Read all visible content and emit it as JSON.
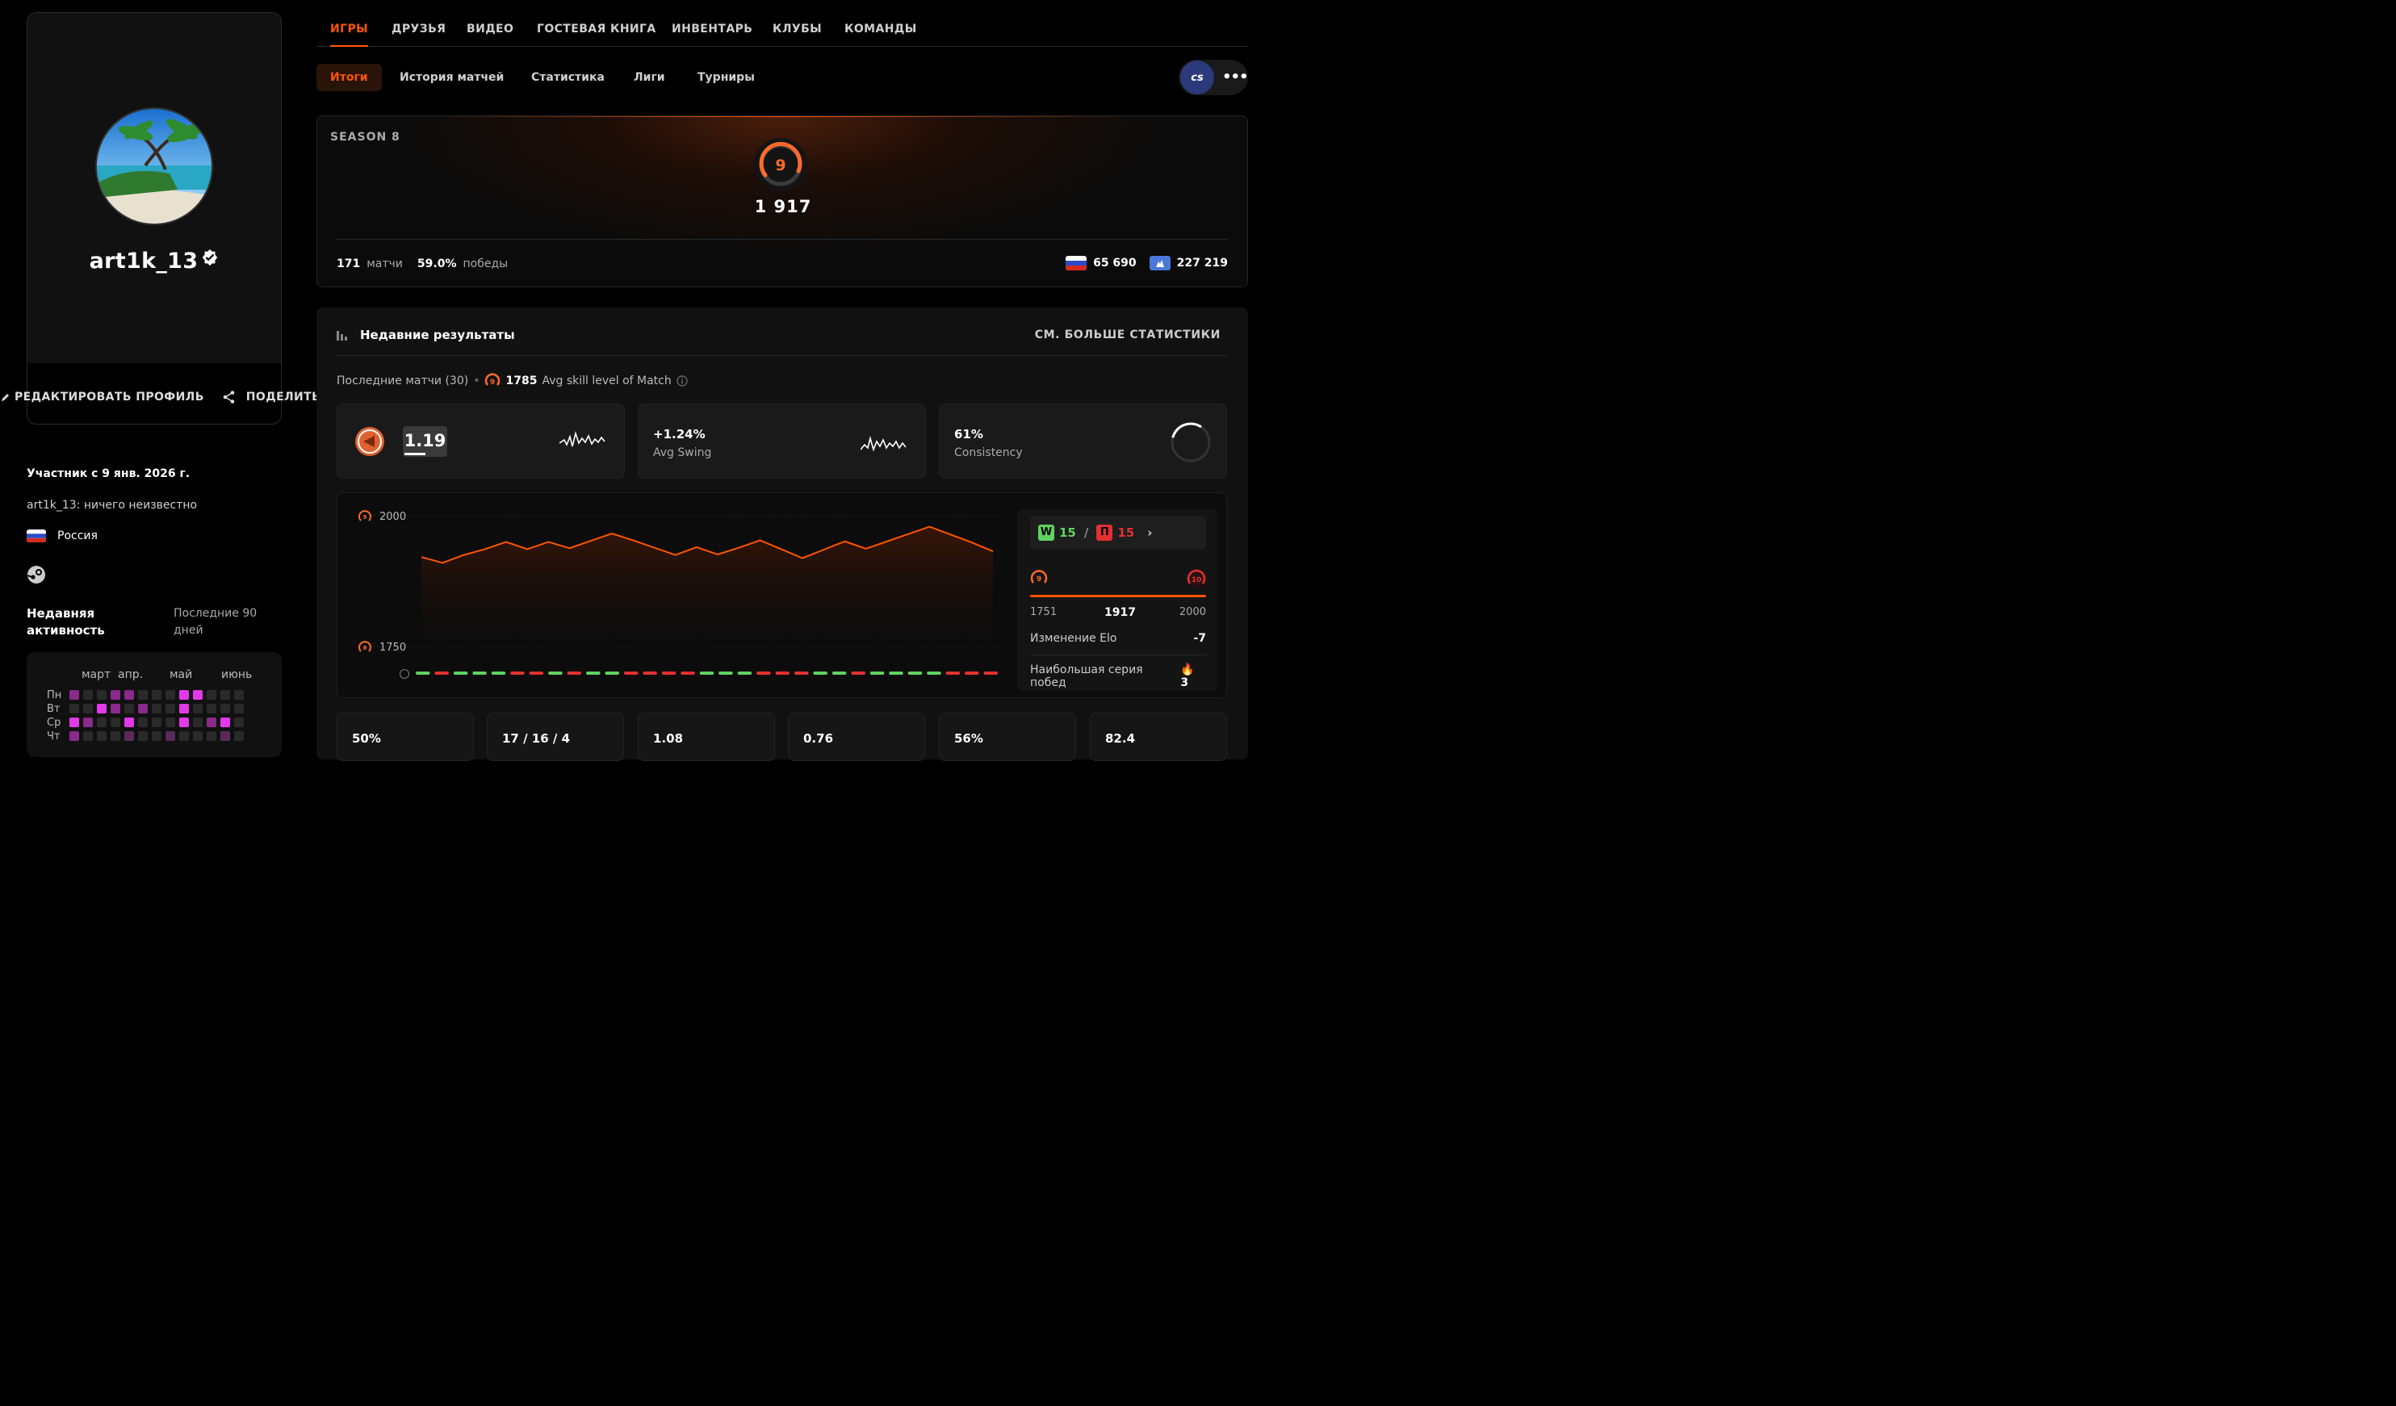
{
  "profile": {
    "username": "art1k_13",
    "edit_label": "РЕДАКТИРОВАТЬ ПРОФИЛЬ",
    "share_label": "ПОДЕЛИТЬСЯ",
    "member_since": "Участник с 9 янв. 2026 г.",
    "bio": "art1k_13: ничего неизвестно",
    "country": "Россия"
  },
  "activity": {
    "title": "Недавняя активность",
    "period": "Последние 90 дней",
    "months": [
      "март",
      "апр.",
      "май",
      "июнь"
    ],
    "days": [
      "Пн",
      "Вт",
      "Ср",
      "Чт"
    ]
  },
  "main_tabs": [
    "ИГРЫ",
    "ДРУЗЬЯ",
    "ВИДЕО",
    "ГОСТЕВАЯ КНИГА",
    "ИНВЕНТАРЬ",
    "КЛУБЫ",
    "КОМАНДЫ"
  ],
  "sub_tabs": [
    "Итоги",
    "История матчей",
    "Статистика",
    "Лиги",
    "Турниры"
  ],
  "game_logo": "cs",
  "more_icon": "•••",
  "season": {
    "label": "SEASON 8",
    "level": "9",
    "elo": "1 917",
    "matches_value": "171",
    "matches_label": "матчи",
    "winrate_value": "59.0%",
    "winrate_label": "победы",
    "country_rank": "65 690",
    "region_rank": "227 219"
  },
  "results": {
    "title": "Недавние результаты",
    "more_stats": "СМ. БОЛЬШЕ СТАТИСТИКИ",
    "last_matches": "Последние матчи (30)",
    "avg_level_badge": "9",
    "avg_skill_value": "1785",
    "avg_skill_label": "Avg skill level of Match",
    "rating": "1.19",
    "avg_swing_value": "+1.24%",
    "avg_swing_label": "Avg Swing",
    "consistency_value": "61%",
    "consistency_label": "Consistency"
  },
  "chart_data": {
    "type": "line",
    "title": "",
    "xlabel": "",
    "ylabel": "",
    "ylim": [
      1750,
      2000
    ],
    "ytick_labels": [
      "2000",
      "1750"
    ],
    "ytick_levels": [
      "9",
      "8"
    ],
    "values": [
      1921,
      1910,
      1925,
      1936,
      1950,
      1936,
      1950,
      1938,
      1952,
      1966,
      1953,
      1939,
      1925,
      1940,
      1926,
      1939,
      1953,
      1936,
      1919,
      1935,
      1951,
      1937,
      1951,
      1965,
      1979,
      1964,
      1949,
      1932
    ],
    "results": [
      "W",
      "L",
      "W",
      "W",
      "W",
      "L",
      "L",
      "W",
      "L",
      "W",
      "W",
      "L",
      "L",
      "L",
      "L",
      "W",
      "W",
      "W",
      "L",
      "L",
      "L",
      "W",
      "W",
      "L",
      "W",
      "W",
      "W",
      "W",
      "L",
      "L",
      "L"
    ],
    "colors": {
      "line": "#ff5500",
      "win": "#5fd35f",
      "loss": "#e53030"
    }
  },
  "side_panel": {
    "wins": "15",
    "losses": "15",
    "win_tag": "W",
    "loss_tag": "П",
    "range_min": "1751",
    "range_current": "1917",
    "range_max": "2000",
    "level_left": "9",
    "level_right": "10",
    "elo_change_label": "Изменение Elo",
    "elo_change_value": "-7",
    "streak_label": "Наибольшая серия побед",
    "streak_value": "3"
  },
  "bottom_stats": [
    "50%",
    "17 / 16 / 4",
    "1.08",
    "0.76",
    "56%",
    "82.4"
  ],
  "colors": {
    "accent": "#ff5500",
    "win": "#5fd35f",
    "loss": "#e53030"
  }
}
